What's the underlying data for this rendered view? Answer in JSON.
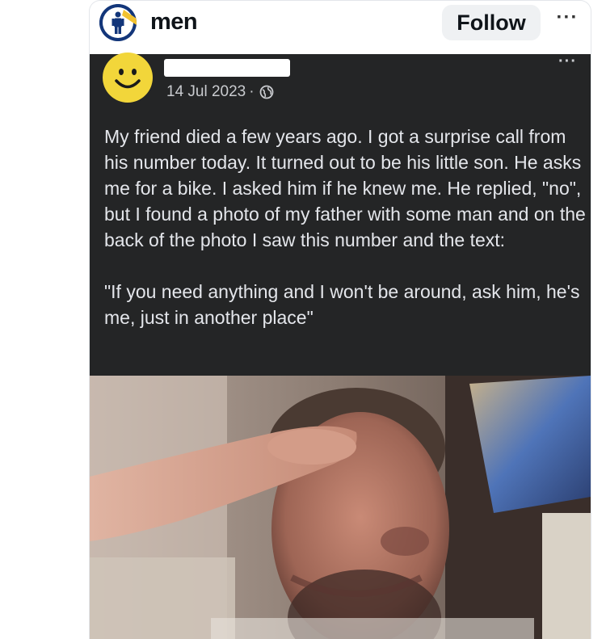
{
  "header": {
    "account_name": "men",
    "follow_label": "Follow",
    "more_label": "···"
  },
  "embedded_post": {
    "date": "14 Jul 2023",
    "separator": "·",
    "more_label": "···",
    "paragraphs": [
      "My friend died a few years ago. I got a surprise call from his number today. It turned out to be his little son. He asks me for a bike. I asked him if he knew me. He replied, \"no\", but I found a photo of my father with some man and on the back of the photo I saw this number and the text:",
      "\"If you need anything and I won't be around, ask him, he's me, just in another place\""
    ]
  },
  "colors": {
    "embed_bg": "#242526",
    "text_light": "#e4e6eb",
    "avatar_bg": "#13367a",
    "smiley": "#f2d63a"
  },
  "icons": {
    "account_avatar": "men-restroom-sign-avatar",
    "fb_avatar": "smiley-face-icon",
    "privacy": "globe-icon"
  }
}
